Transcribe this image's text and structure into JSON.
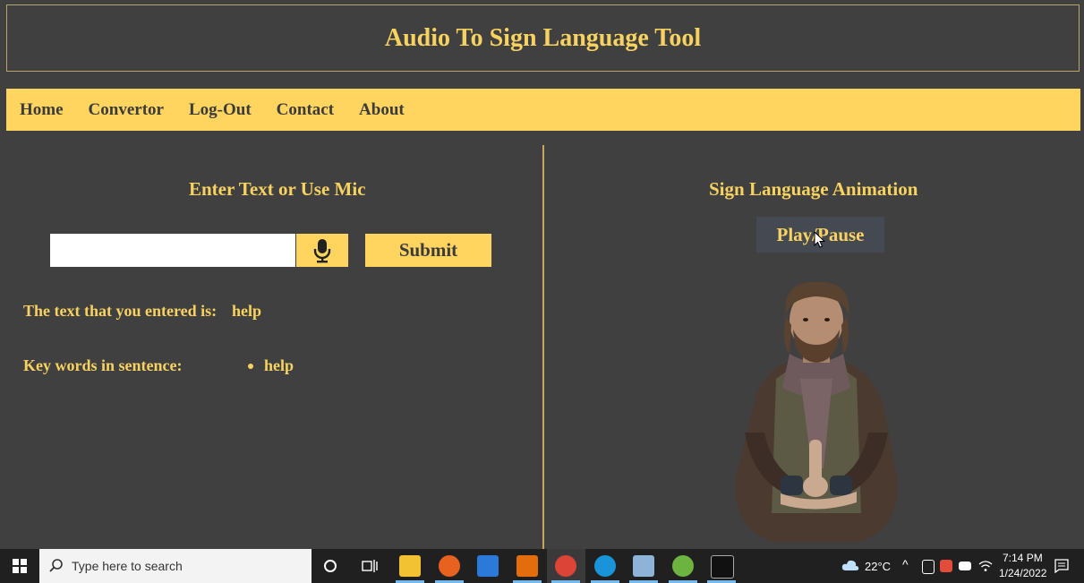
{
  "app": {
    "title": "Audio To Sign Language Tool"
  },
  "nav": {
    "items": [
      "Home",
      "Convertor",
      "Log-Out",
      "Contact",
      "About"
    ]
  },
  "left": {
    "heading": "Enter Text or Use Mic",
    "input_value": "",
    "submit_label": "Submit",
    "entered_label": "The text that you entered is:",
    "entered_value": "help",
    "keywords_label": "Key words in sentence:",
    "keywords": [
      "help"
    ]
  },
  "right": {
    "heading": "Sign Language Animation",
    "play_label": "Play/Pause"
  },
  "taskbar": {
    "search_placeholder": "Type here to search",
    "weather": "22°C",
    "time": "7:14 PM",
    "date": "1/24/2022"
  },
  "colors": {
    "background": "#404040",
    "accent": "#ffd45f",
    "text": "#f8d260"
  }
}
